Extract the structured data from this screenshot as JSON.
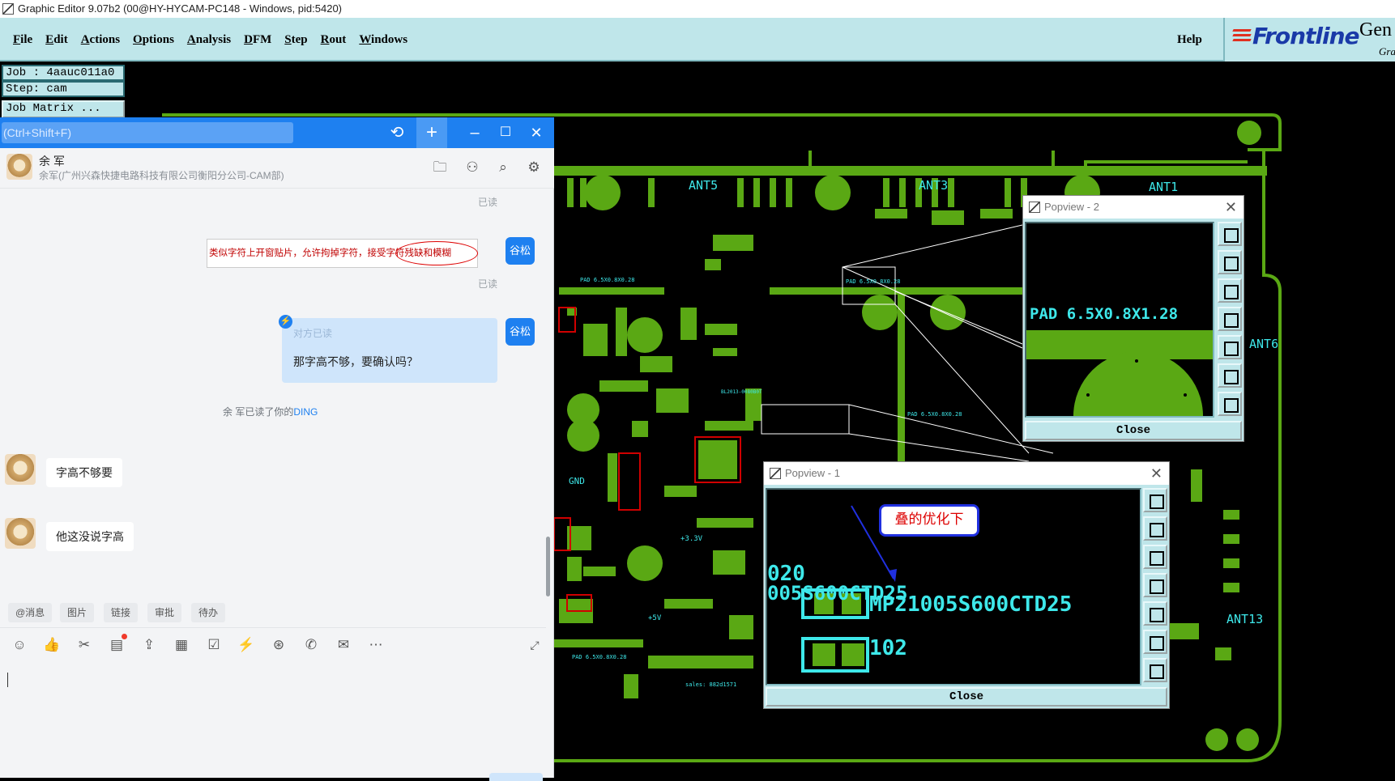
{
  "window": {
    "title": "Graphic Editor 9.07b2 (00@HY-HYCAM-PC148 - Windows, pid:5420)"
  },
  "menubar": {
    "items": [
      "File",
      "Edit",
      "Actions",
      "Options",
      "Analysis",
      "DFM",
      "Step",
      "Rout",
      "Windows"
    ],
    "help": "Help",
    "logo": "Frontline",
    "logo_gen": "Gen",
    "logo_gra": "Gra"
  },
  "job": {
    "job_line": "Job : 4aauc011a0",
    "step_line": "Step: cam",
    "matrix_button": "Job Matrix ..."
  },
  "pcb": {
    "labels": [
      "ANT5",
      "ANT3",
      "ANT1",
      "ANT6",
      "ANT13"
    ],
    "pad_labels": [
      "PAD 6.5X0.8X0.28",
      "PAD 6.5X0.8X0.28",
      "PAD 6.5X0.8X0.28",
      "PAD 6.5X0.8X0.28"
    ],
    "misc": [
      "GND",
      "+3.3V",
      "+5V",
      "BL2013-0080B0T",
      "sales: 882d1571"
    ],
    "colors": {
      "copper": "#5aa814",
      "silk": "#3ee8ea",
      "outline": "#d00000"
    }
  },
  "chat": {
    "search_placeholder": "(Ctrl+Shift+F)",
    "contact_name": "余  军",
    "contact_sub": "余军(广州兴森快捷电路科技有限公司衡阳分公司-CAM部)",
    "read_label": "已读",
    "me_name": "谷松",
    "image_message": "类似字符上开窗贴片，允许拘掉字符，接受字符残缺和模糊",
    "bubble_hint": "对方已读",
    "bubble_text": "那字高不够，要确认吗？",
    "ding_note_prefix": "余 军已读了你的",
    "ding_note_link": "DING",
    "other_messages": [
      "字高不够要",
      "他这没说字高"
    ],
    "quick_buttons": [
      "@消息",
      "图片",
      "链接",
      "审批",
      "待办"
    ],
    "tool_icons": [
      "emoji-icon",
      "thumbs-up-icon",
      "scissors-icon",
      "doc-icon",
      "upload-icon",
      "calendar-icon",
      "checkbox-icon",
      "lightning-icon",
      "at-icon",
      "phone-icon",
      "mail-icon",
      "more-icon"
    ]
  },
  "popview2": {
    "title": "Popview - 2",
    "pad_text": "PAD 6.5X0.8X1.28",
    "close": "Close"
  },
  "popview1": {
    "title": "Popview - 1",
    "annotation": "叠的优化下",
    "text_a": "020",
    "text_b": "005S600CTD25",
    "text_c": "MP21005S600CTD25",
    "text_d": "102",
    "close": "Close"
  }
}
